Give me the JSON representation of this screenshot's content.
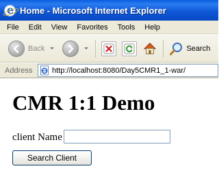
{
  "window": {
    "title": "Home - Microsoft Internet Explorer"
  },
  "menu": {
    "items": [
      "File",
      "Edit",
      "View",
      "Favorites",
      "Tools",
      "Help"
    ]
  },
  "toolbar": {
    "back_label": "Back",
    "search_label": "Search",
    "icons": [
      "back-arrow-icon",
      "forward-arrow-icon",
      "stop-icon",
      "refresh-icon",
      "home-icon",
      "search-magnifier-icon"
    ]
  },
  "address": {
    "label": "Address",
    "url": "http://localhost:8080/Day5CMR1_1-war/"
  },
  "page": {
    "heading": "CMR 1:1 Demo",
    "client_name_label": "client Name",
    "client_name_value": "",
    "search_button_label": "Search Client"
  },
  "colors": {
    "titlebar": "#0a5fe0",
    "chrome": "#ece9d8",
    "input_border": "#7f9db9"
  }
}
